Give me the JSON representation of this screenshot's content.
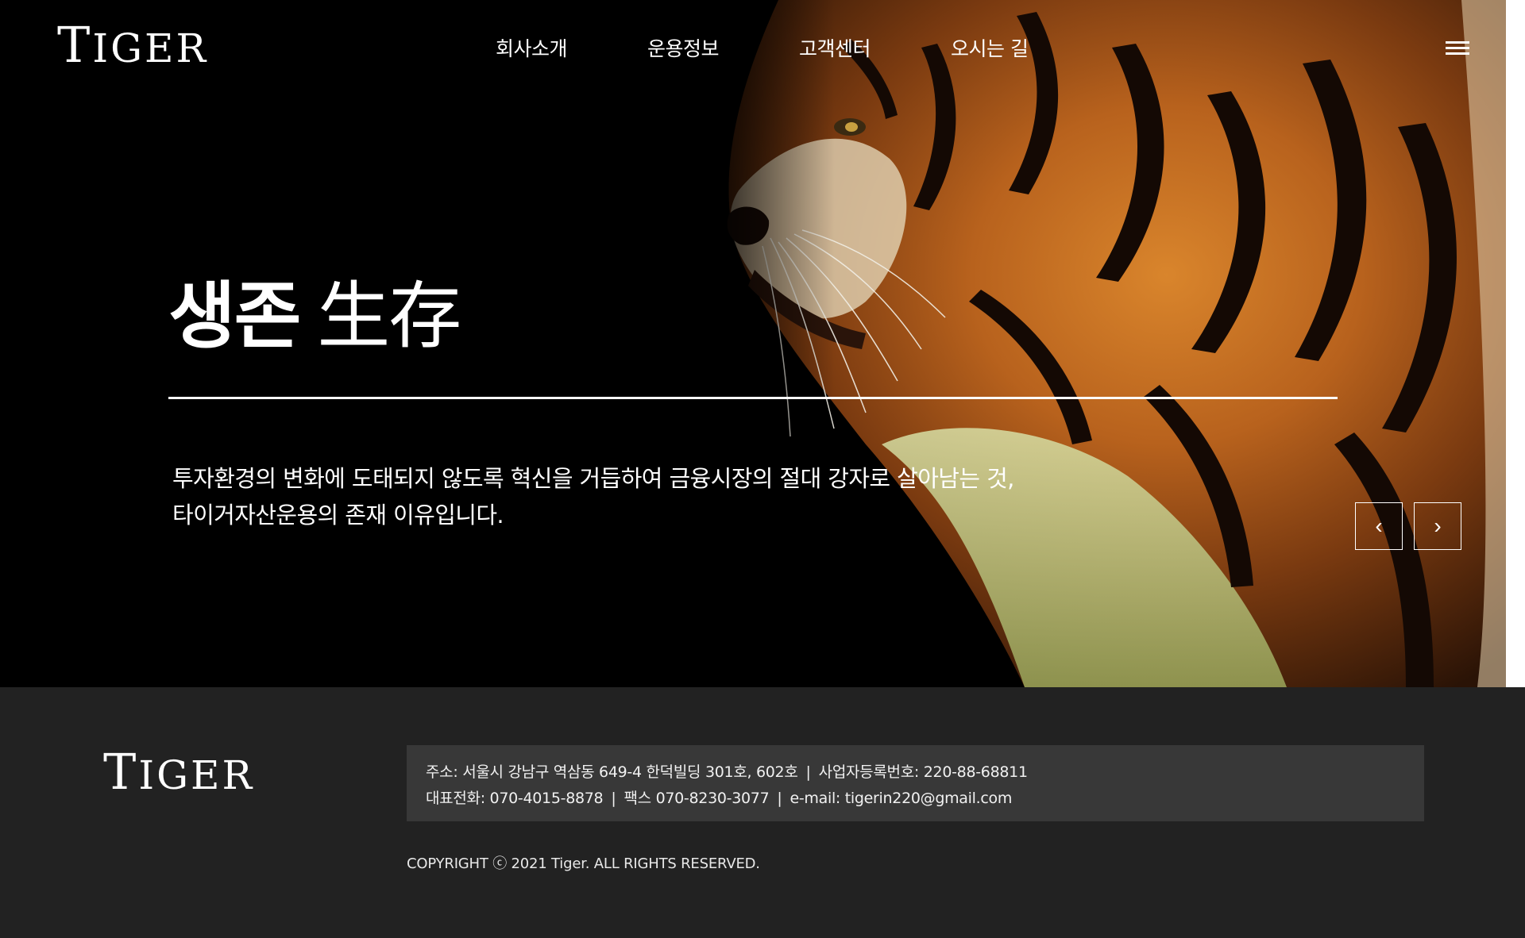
{
  "header": {
    "logo": {
      "first": "T",
      "rest": "IGER"
    },
    "nav": [
      {
        "label": "회사소개"
      },
      {
        "label": "운용정보"
      },
      {
        "label": "고객센터"
      },
      {
        "label": "오시는 길"
      }
    ],
    "menu_icon": "hamburger-icon"
  },
  "hero": {
    "title_korean": "생존",
    "title_hanja": "生存",
    "description_line1": "투자환경의 변화에 도태되지 않도록 혁신을 거듭하여 금융시장의 절대 강자로 살아남는 것,",
    "description_line2": "타이거자산운용의 존재 이유입니다.",
    "prev_label": "‹",
    "next_label": "›"
  },
  "footer": {
    "logo": {
      "first": "T",
      "rest": "IGER"
    },
    "address_label": "주소: 서울시 강남구 역삼동 649-4 한덕빌딩 301호, 602호",
    "biz_number_label": "사업자등록번호: 220-88-68811",
    "phone_label": "대표전화: 070-4015-8878",
    "fax_label": "팩스 070-8230-3077",
    "email_label": "e-mail: tigerin220@gmail.com",
    "separator": "|",
    "copyright": "COPYRIGHT ⓒ 2021 Tiger. ALL RIGHTS RESERVED."
  },
  "colors": {
    "hero_bg": "#000000",
    "footer_bg": "#222222",
    "info_box_bg": "#383838",
    "text": "#ffffff"
  }
}
